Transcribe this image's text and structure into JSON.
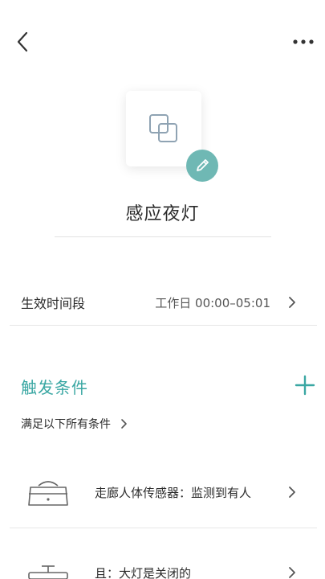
{
  "header": {
    "back_icon": "chevron-left-icon",
    "more_icon": "more-dots-icon"
  },
  "scene": {
    "icon": "scene-squares-icon",
    "edit_icon": "pencil-icon",
    "accent_color": "#6fb8b4",
    "name": "感应夜灯"
  },
  "effective_period": {
    "label": "生效时间段",
    "value": "工作日 00:00–05:01"
  },
  "triggers": {
    "title": "触发条件",
    "title_color": "#3aa7a3",
    "add_icon": "plus-icon",
    "mode_label": "满足以下所有条件",
    "conditions": [
      {
        "icon": "body-sensor-icon",
        "text": "走廊人体传感器：监测到有人"
      },
      {
        "icon": "ceiling-light-icon",
        "text": "且：大灯是关闭的"
      }
    ]
  }
}
